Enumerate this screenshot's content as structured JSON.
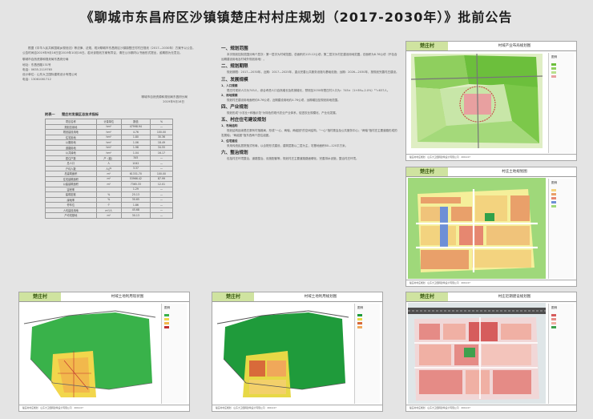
{
  "page": {
    "title": "《聊城市东昌府区沙镇镇楚庄村村庄规划（2017-2030年）》批前公告"
  },
  "notice": {
    "body_1": "根据《中华人民共和国城乡规划法》等法律、法规，现对聊城市东昌府区沙镇镇楚庄村村庄规划（2017—2030年）方案予以公告，公告时间自2019年9月16日至2019年10月16日。若对该规划方案有异议，请在公示期内以书面形式提出，逾期视为无意见。",
    "body_2": "聊城市自然资源和规划局东昌府分局",
    "contact_1": "地址：东昌西路131号",
    "contact_2": "电话：0635-2119765",
    "contact_3": "设计单位：山东大卫国际建筑设计有限公司",
    "contact_4": "电话：13061081712",
    "signature": "聊城市自然资源和规划局东昌府分局",
    "date": "2019年9月16日"
  },
  "table": {
    "caption": "附表一　　楚庄村发展区总技术指标",
    "rows": [
      [
        "项目名称",
        "计量单位",
        "数值",
        "%"
      ],
      [
        "规划总用地",
        "hm²",
        "47998.94",
        "—"
      ],
      [
        "规划建设用地",
        "hm²",
        "4.76",
        "100.00"
      ],
      [
        "住宅用地",
        "hm²",
        "1.80",
        "30.36"
      ],
      [
        "公服用地",
        "hm²",
        "1.06",
        "18.49"
      ],
      [
        "道路用地",
        "hm²",
        "1.98",
        "34.55"
      ],
      [
        "公共绿地",
        "hm²",
        "1.04",
        "16.17"
      ],
      [
        "居住户数",
        "户（套）",
        "345",
        "—"
      ],
      [
        "总人口",
        "人",
        "1042",
        "—"
      ],
      [
        "户均人数",
        "人/户",
        "3.37",
        "—"
      ],
      [
        "总建筑面积",
        "m²",
        "61331.70",
        "100.00"
      ],
      [
        "住宅建筑面积",
        "m²",
        "53966.42",
        "87.99"
      ],
      [
        "公建建筑面积",
        "m²",
        "7365.33",
        "12.01"
      ],
      [
        "容积率",
        "",
        "1.29",
        "—"
      ],
      [
        "建筑密度",
        "%",
        "25.13",
        "—"
      ],
      [
        "绿地率",
        "%",
        "30.65",
        "—"
      ],
      [
        "停车位",
        "个",
        "1.86",
        "—"
      ],
      [
        "人均建设用地",
        "m²/人",
        "45.68",
        "—"
      ],
      [
        "户均宅基地",
        "m²",
        "30.13",
        "—"
      ]
    ]
  },
  "plan": {
    "h1": "一、规划范围",
    "p1": "本次规划控制范围分两个层次：第一层次为村域范围，总面积约115.12公顷；第二层次为村庄建设用地范围，总面积为8.76公顷（不包含远期建设用地及村域外规划用地）。",
    "h2": "二、规划期限",
    "p2": "规划期限：2017—2030年。近期：2017—2025年，重点完善公共服务设施与基础设施；远期：2026—2030年，按规划完善村庄建设。",
    "h3": "三、发展规模",
    "s31": "1、人口规模",
    "p31": "楚庄村现状人口为745人，综合考虑人口自然增长及机械增长，预测至2030年楚庄村人口为：745×（1+8‰-2.0%）¹³=637人。",
    "s32": "2、用地规模",
    "p32": "规划村庄建设用地面积约8.76公顷，近期建设用地约4.76公顷，远期增加至规划用地范围。",
    "h4": "四、产业规划",
    "p4": "规划形成\"小农业+种植示范\"为特色的现代农业产业体系，促进农业规模化、产业化发展。",
    "h5": "五、村庄住宅建设规划",
    "s51": "1、布局结构",
    "p51": "规划结构延续楚庄原有村落格局，形成\"一心、两轴、两组团\"的空间结构。\"一心\"指村委会及公共服务中心；\"两轴\"指村庄主要道路形成的发展轴；\"两组团\"指东西两个居住组团。",
    "s52": "2、住宅建设",
    "p52": "采用传统民居院落式布局，以合院形式建设，建筑层数以二层为主，宅基地面积80—120平方米。",
    "h6": "六、整治规划",
    "p6": "包括村庄环境整治、道路整治、设施配套等，规划村庄主要道路路面硬化，完善排水设施，整治村庄环境。"
  },
  "maps": [
    {
      "badge": "楚庄村",
      "title": "村域产业布局规划图",
      "footer": "楚庄村村庄规划　山东大卫国际建筑设计有限公司　2019.07",
      "legend": "图例"
    },
    {
      "badge": "楚庄村",
      "title": "村庄土地规划图",
      "footer": "楚庄村村庄规划　山东大卫国际建筑设计有限公司　2019.07",
      "legend": "图例"
    },
    {
      "badge": "楚庄村",
      "title": "村域土地利用现状图",
      "footer": "楚庄村村庄规划　山东大卫国际建筑设计有限公司　2019.07",
      "legend": "图例"
    },
    {
      "badge": "楚庄村",
      "title": "村域土地利用规划图",
      "footer": "楚庄村村庄规划　山东大卫国际建筑设计有限公司　2019.07",
      "legend": "图例"
    },
    {
      "badge": "楚庄村",
      "title": "村庄近期建设规划图",
      "footer": "楚庄村村庄规划　山东大卫国际建筑设计有限公司　2019.07",
      "legend": "图例"
    }
  ],
  "colors": {
    "green": "#1f9b3b",
    "yellow": "#f0e14a",
    "orange": "#f09a3a",
    "red": "#d63a2a",
    "blue": "#3e6fd8",
    "pink": "#f1b4b4",
    "grey": "#bfbfbf",
    "brown": "#b77a3c"
  }
}
